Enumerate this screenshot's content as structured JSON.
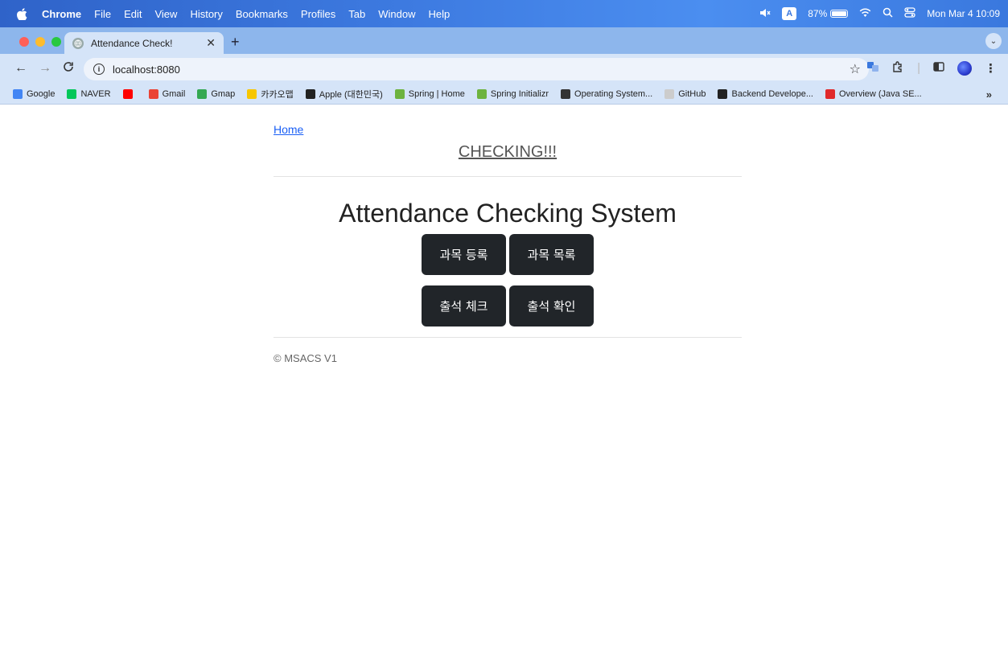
{
  "menubar": {
    "app_name": "Chrome",
    "items": [
      "File",
      "Edit",
      "View",
      "History",
      "Bookmarks",
      "Profiles",
      "Tab",
      "Window",
      "Help"
    ],
    "input_indicator": "A",
    "battery_percent": "87%",
    "battery_level": 0.87,
    "datetime": "Mon Mar 4  10:09"
  },
  "browser": {
    "tab_title": "Attendance Check!",
    "url": "localhost:8080",
    "bookmarks": [
      {
        "label": "Google",
        "icon": "google-icon",
        "color": "#4285f4"
      },
      {
        "label": "NAVER",
        "icon": "naver-icon",
        "color": "#03c75a"
      },
      {
        "label": "",
        "icon": "youtube-icon",
        "color": "#ff0000"
      },
      {
        "label": "Gmail",
        "icon": "gmail-icon",
        "color": "#ea4335"
      },
      {
        "label": "Gmap",
        "icon": "map-pin-icon",
        "color": "#34a853"
      },
      {
        "label": "카카오맵",
        "icon": "kakaomap-icon",
        "color": "#f7c600"
      },
      {
        "label": "Apple (대한민국)",
        "icon": "apple-icon",
        "color": "#222222"
      },
      {
        "label": "Spring | Home",
        "icon": "spring-icon",
        "color": "#6db33f"
      },
      {
        "label": "Spring Initializr",
        "icon": "spring-icon",
        "color": "#6db33f"
      },
      {
        "label": "Operating System...",
        "icon": "globe-icon",
        "color": "#333333"
      },
      {
        "label": "GitHub",
        "icon": "github-icon",
        "color": "#cccccc"
      },
      {
        "label": "Backend Develope...",
        "icon": "backend-icon",
        "color": "#222222"
      },
      {
        "label": "Overview (Java SE...",
        "icon": "oracle-icon",
        "color": "#e0292b"
      }
    ]
  },
  "page": {
    "home_link": "Home",
    "brand": "CHECKING!!!",
    "heading": "Attendance Checking System",
    "buttons": {
      "register_course": "과목 등록",
      "course_list": "과목 목록",
      "check_attendance": "출석 체크",
      "view_attendance": "출석 확인"
    },
    "footer": "© MSACS V1"
  }
}
